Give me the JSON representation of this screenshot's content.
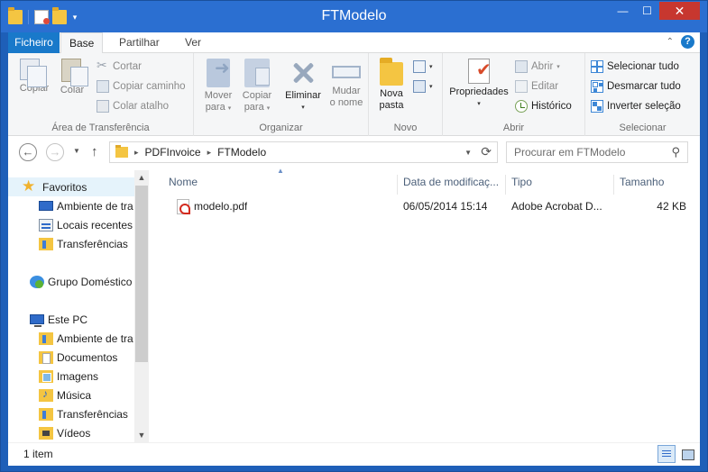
{
  "window": {
    "title": "FTModelo",
    "controls": {
      "minimize": "—",
      "maximize": "☐",
      "close": "✕"
    }
  },
  "quick_access": {
    "dropdown": "▾"
  },
  "ribbon_tabs": [
    {
      "label": "Ficheiro"
    },
    {
      "label": "Base"
    },
    {
      "label": "Partilhar"
    },
    {
      "label": "Ver"
    }
  ],
  "ribbon_controls": {
    "collapse": "⌃",
    "help": "?"
  },
  "ribbon": {
    "clipboard": {
      "label": "Área de Transferência",
      "copy": "Copiar",
      "paste": "Colar",
      "cut": "Cortar",
      "copy_path": "Copiar caminho",
      "paste_shortcut": "Colar atalho"
    },
    "organize": {
      "label": "Organizar",
      "move_to_1": "Mover",
      "move_to_2": "para",
      "copy_to_1": "Copiar",
      "copy_to_2": "para",
      "delete": "Eliminar",
      "rename_1": "Mudar",
      "rename_2": "o nome"
    },
    "new": {
      "label": "Novo",
      "new_folder_1": "Nova",
      "new_folder_2": "pasta"
    },
    "open": {
      "label": "Abrir",
      "properties": "Propriedades",
      "open": "Abrir",
      "edit": "Editar",
      "history": "Histórico"
    },
    "select": {
      "label": "Selecionar",
      "select_all": "Selecionar tudo",
      "select_none": "Desmarcar tudo",
      "invert": "Inverter seleção"
    }
  },
  "address": {
    "back": "←",
    "forward": "→",
    "up": "↑",
    "breadcrumbs": [
      "PDFInvoice",
      "FTModelo"
    ],
    "search_placeholder": "Procurar em FTModelo"
  },
  "nav_pane": {
    "favorites": {
      "label": "Favoritos",
      "items": [
        "Ambiente de tra",
        "Locais recentes",
        "Transferências"
      ]
    },
    "homegroup": {
      "label": "Grupo Doméstico"
    },
    "this_pc": {
      "label": "Este PC",
      "items": [
        "Ambiente de tra",
        "Documentos",
        "Imagens",
        "Música",
        "Transferências",
        "Vídeos"
      ]
    }
  },
  "file_list": {
    "columns": [
      "Nome",
      "Data de modificaç...",
      "Tipo",
      "Tamanho"
    ],
    "rows": [
      {
        "name": "modelo.pdf",
        "modified": "06/05/2014 15:14",
        "type": "Adobe Acrobat D...",
        "size": "42 KB"
      }
    ]
  },
  "status": {
    "items": "1 item"
  },
  "colors": {
    "title_bar": "#2b6fd1",
    "file_tab": "#1979ca",
    "window_frame": "#1e5fb8"
  }
}
